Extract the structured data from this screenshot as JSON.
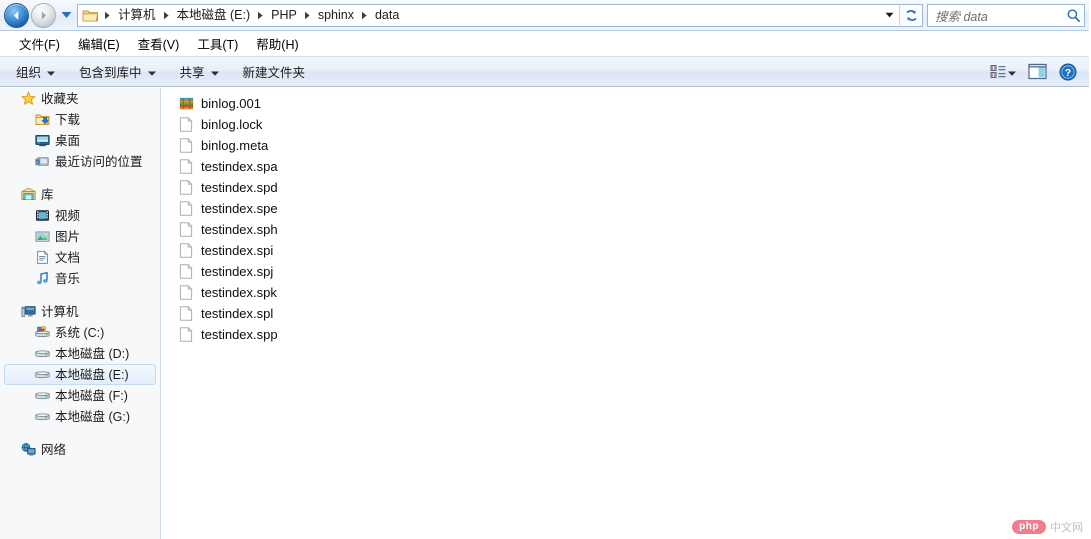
{
  "window": {
    "title": "data"
  },
  "address_bar": {
    "back_button": "back-icon",
    "forward_button": "forward-icon",
    "history_dropdown": "chevron-down-icon",
    "folder_icon": "folder-icon",
    "breadcrumbs": [
      "计算机",
      "本地磁盘 (E:)",
      "PHP",
      "sphinx",
      "data"
    ],
    "path_dropdown": "chevron-down-icon",
    "refresh_button": "refresh-icon",
    "search": {
      "placeholder": "搜索 data",
      "value": "",
      "icon": "search-icon"
    }
  },
  "menu_bar": {
    "items": [
      {
        "label": "文件(F)"
      },
      {
        "label": "编辑(E)"
      },
      {
        "label": "查看(V)"
      },
      {
        "label": "工具(T)"
      },
      {
        "label": "帮助(H)"
      }
    ]
  },
  "toolbar": {
    "items": [
      {
        "label": "组织",
        "has_dropdown": true
      },
      {
        "label": "包含到库中",
        "has_dropdown": true
      },
      {
        "label": "共享",
        "has_dropdown": true
      },
      {
        "label": "新建文件夹",
        "has_dropdown": false
      }
    ],
    "right_icons": [
      {
        "name": "view-mode-icon",
        "has_dropdown": true
      },
      {
        "name": "preview-pane-icon",
        "has_dropdown": false
      },
      {
        "name": "help-icon",
        "has_dropdown": false
      }
    ]
  },
  "sidebar": {
    "groups": [
      {
        "header": {
          "label": "收藏夹",
          "icon": "star-icon"
        },
        "items": [
          {
            "label": "下载",
            "icon": "downloads-icon",
            "selected": false
          },
          {
            "label": "桌面",
            "icon": "desktop-icon",
            "selected": false
          },
          {
            "label": "最近访问的位置",
            "icon": "recent-places-icon",
            "selected": false
          }
        ]
      },
      {
        "header": {
          "label": "库",
          "icon": "library-icon"
        },
        "items": [
          {
            "label": "视频",
            "icon": "video-icon",
            "selected": false
          },
          {
            "label": "图片",
            "icon": "pictures-icon",
            "selected": false
          },
          {
            "label": "文档",
            "icon": "documents-icon",
            "selected": false
          },
          {
            "label": "音乐",
            "icon": "music-icon",
            "selected": false
          }
        ]
      },
      {
        "header": {
          "label": "计算机",
          "icon": "computer-icon"
        },
        "items": [
          {
            "label": "系统 (C:)",
            "icon": "system-drive-icon",
            "selected": false
          },
          {
            "label": "本地磁盘 (D:)",
            "icon": "drive-icon",
            "selected": false
          },
          {
            "label": "本地磁盘 (E:)",
            "icon": "drive-icon",
            "selected": true
          },
          {
            "label": "本地磁盘 (F:)",
            "icon": "drive-icon",
            "selected": false
          },
          {
            "label": "本地磁盘 (G:)",
            "icon": "drive-icon",
            "selected": false
          }
        ]
      },
      {
        "header": {
          "label": "网络",
          "icon": "network-icon"
        },
        "items": []
      }
    ]
  },
  "file_list": {
    "files": [
      {
        "name": "binlog.001",
        "icon": "archive-icon"
      },
      {
        "name": "binlog.lock",
        "icon": "blank-file-icon"
      },
      {
        "name": "binlog.meta",
        "icon": "blank-file-icon"
      },
      {
        "name": "testindex.spa",
        "icon": "blank-file-icon"
      },
      {
        "name": "testindex.spd",
        "icon": "blank-file-icon"
      },
      {
        "name": "testindex.spe",
        "icon": "blank-file-icon"
      },
      {
        "name": "testindex.sph",
        "icon": "blank-file-icon"
      },
      {
        "name": "testindex.spi",
        "icon": "blank-file-icon"
      },
      {
        "name": "testindex.spj",
        "icon": "blank-file-icon"
      },
      {
        "name": "testindex.spk",
        "icon": "blank-file-icon"
      },
      {
        "name": "testindex.spl",
        "icon": "blank-file-icon"
      },
      {
        "name": "testindex.spp",
        "icon": "blank-file-icon"
      }
    ]
  },
  "watermark": {
    "badge": "php",
    "text": "中文网",
    "badge_color": "#f06a7e"
  },
  "colors": {
    "accent": "#1c5fa8",
    "toolbar_top": "#f3f7fd",
    "toolbar_bottom": "#dce6f4",
    "sidebar_bg": "#f7f8fa",
    "selection_border": "#c3dcf2"
  }
}
